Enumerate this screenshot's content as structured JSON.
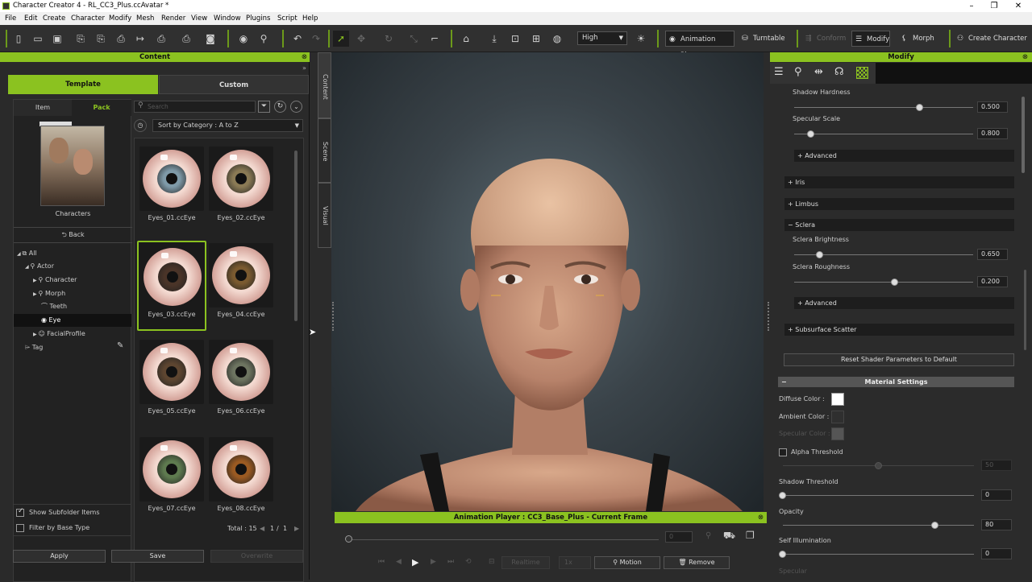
{
  "app": {
    "title": "Character Creator 4 - RL_CC3_Plus.ccAvatar *",
    "window_controls": [
      "–",
      "❐",
      "✕"
    ]
  },
  "menu": [
    "File",
    "Edit",
    "Create",
    "Character",
    "Modify",
    "Mesh",
    "Render",
    "View",
    "Window",
    "Plugins",
    "Script",
    "Help"
  ],
  "toolbar": {
    "quality": "High",
    "animation_player": "Animation Player",
    "turntable": "Turntable",
    "conform": "Conform",
    "modify": "Modify",
    "morph": "Morph",
    "create_character": "Create Character"
  },
  "content": {
    "title": "Content",
    "tabs": [
      "Template",
      "Custom"
    ],
    "subtabs": [
      "Item",
      "Pack"
    ],
    "pack_caption": "Characters",
    "back": "Back",
    "search_placeholder": "Search",
    "sort": "Sort by Category : A to Z",
    "tree": [
      {
        "label": "All",
        "level": 0
      },
      {
        "label": "Actor",
        "level": 1
      },
      {
        "label": "Character",
        "level": 2
      },
      {
        "label": "Morph",
        "level": 2
      },
      {
        "label": "Teeth",
        "level": 2
      },
      {
        "label": "Eye",
        "level": 2
      },
      {
        "label": "FacialProfile",
        "level": 2
      },
      {
        "label": "Tag",
        "level": 0
      }
    ],
    "items": [
      {
        "name": "Eyes_01.ccEye",
        "iris": "#7f9aa8"
      },
      {
        "name": "Eyes_02.ccEye",
        "iris": "#8a7a55"
      },
      {
        "name": "Eyes_03.ccEye",
        "iris": "#4a3428"
      },
      {
        "name": "Eyes_04.ccEye",
        "iris": "#7a5a30"
      },
      {
        "name": "Eyes_05.ccEye",
        "iris": "#5d4530"
      },
      {
        "name": "Eyes_06.ccEye",
        "iris": "#6d7460"
      },
      {
        "name": "Eyes_07.ccEye",
        "iris": "#5e7a4f"
      },
      {
        "name": "Eyes_08.ccEye",
        "iris": "#9a5a22"
      }
    ],
    "show_subfolder": "Show Subfolder Items",
    "filter_base": "Filter by Base Type",
    "total": "Total : 15",
    "page": "1",
    "page_sep": "/",
    "pages": "1",
    "apply": "Apply",
    "save": "Save",
    "overwrite": "Overwrite"
  },
  "sidetabs": [
    "Content",
    "Scene",
    "Visual"
  ],
  "animation": {
    "title": "Animation Player : CC3_Base_Plus - Current Frame",
    "frame": "0",
    "realtime": "Realtime",
    "speed": "1x",
    "motion": "Motion",
    "remove": "Remove"
  },
  "modify": {
    "title": "Modify",
    "params": [
      {
        "label": "Shadow Hardness",
        "value": "0.500",
        "pos": 0.7
      },
      {
        "label": "Specular Scale",
        "value": "0.800",
        "pos": 0.09
      },
      {
        "label": "Sclera Brightness",
        "value": "0.650",
        "pos": 0.14
      },
      {
        "label": "Sclera Roughness",
        "value": "0.200",
        "pos": 0.56
      }
    ],
    "advanced": "Advanced",
    "sections": [
      "Iris",
      "Limbus",
      "Sclera",
      "Subsurface Scatter"
    ],
    "reset": "Reset Shader Parameters to Default",
    "material_settings": "Material Settings",
    "diffuse": "Diffuse Color :",
    "ambient": "Ambient Color :",
    "specular": "Specular Color :",
    "alpha_threshold": "Alpha Threshold",
    "alpha_value": "50",
    "shadow_threshold": "Shadow Threshold",
    "shadow_value": "0",
    "opacity": "Opacity",
    "opacity_value": "80",
    "self_illum": "Self Illumination",
    "self_value": "0",
    "specular_label": "Specular",
    "colors": {
      "accent": "#8bc220",
      "diffuse": "#ffffff",
      "ambient": "#2f2f2f",
      "specular": "#555555"
    }
  }
}
